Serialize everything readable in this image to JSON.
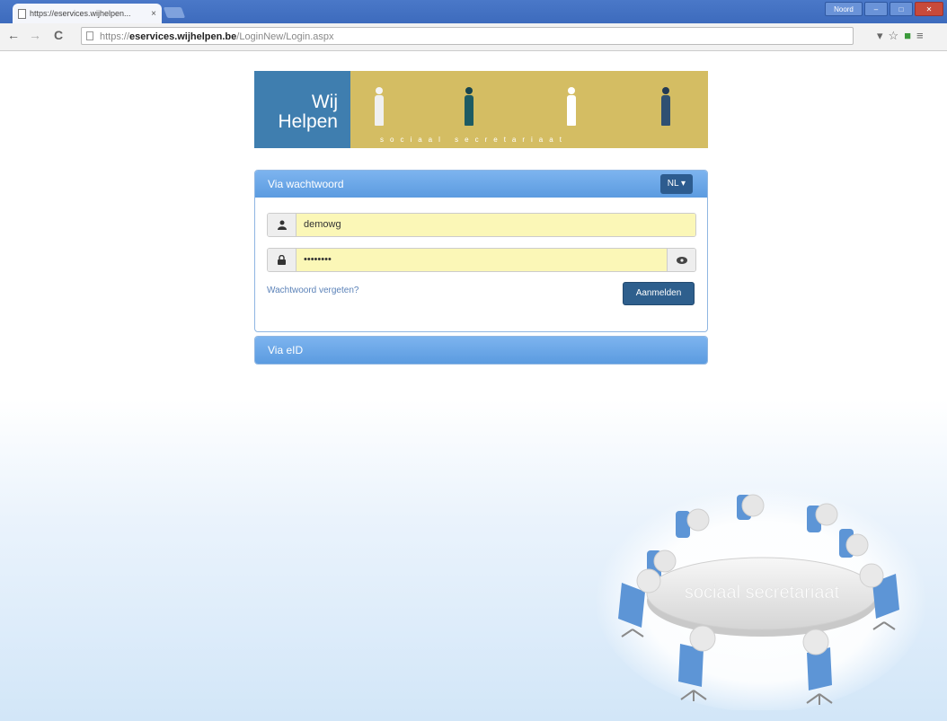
{
  "browser": {
    "tab_title": "https://eservices.wijhelpen...",
    "tab_close": "×",
    "window_user": "Noord",
    "url_prefix": "https://",
    "url_host": "eservices.wijhelpen.be",
    "url_path": "/LoginNew/Login.aspx",
    "nav_back": "←",
    "nav_forward": "→",
    "nav_reload": "C"
  },
  "branding": {
    "logo_line1": "Wij",
    "logo_line2": "Helpen",
    "tagline": "sociaal secretariaat"
  },
  "login_password": {
    "title": "Via wachtwoord",
    "language": "NL",
    "username": "demowg",
    "password": "••••••••",
    "forgot_link": "Wachtwoord vergeten?",
    "submit": "Aanmelden"
  },
  "login_eid": {
    "title": "Via eID"
  },
  "illustration": {
    "table_text": "sociaal secretariaat"
  },
  "colors": {
    "accent": "#5b9be0",
    "button": "#2e5f8d",
    "banner": "#d4bd63",
    "logo": "#3f7eaf",
    "field_fill": "#fbf7b7"
  }
}
